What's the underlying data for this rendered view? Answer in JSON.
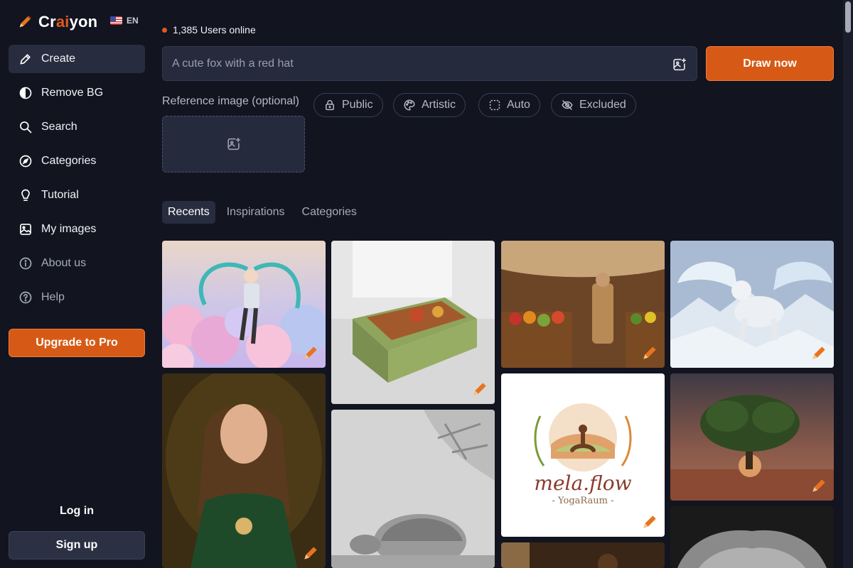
{
  "app": {
    "logo_prefix": "Cr",
    "logo_ai": "ai",
    "logo_suffix": "yon",
    "language": "EN"
  },
  "nav": {
    "create": "Create",
    "remove_bg": "Remove BG",
    "search": "Search",
    "categories": "Categories",
    "tutorial": "Tutorial",
    "my_images": "My images",
    "about_us": "About us",
    "help": "Help"
  },
  "account": {
    "upgrade": "Upgrade to Pro",
    "login": "Log in",
    "signup": "Sign up"
  },
  "status": {
    "online_text": "1,385 Users online"
  },
  "prompt": {
    "placeholder": "A cute fox with a red hat",
    "draw_button": "Draw now"
  },
  "reference": {
    "label": "Reference image (optional)"
  },
  "options": {
    "public": "Public",
    "artistic": "Artistic",
    "auto": "Auto",
    "excluded": "Excluded"
  },
  "tabs": {
    "recents": "Recents",
    "inspirations": "Inspirations",
    "categories": "Categories"
  },
  "gallery": {
    "logo_card_title": "mela.flow",
    "logo_card_subtitle": "YogaRaum"
  },
  "colors": {
    "accent": "#d65a16",
    "background": "#121420",
    "surface": "#262a3d"
  }
}
